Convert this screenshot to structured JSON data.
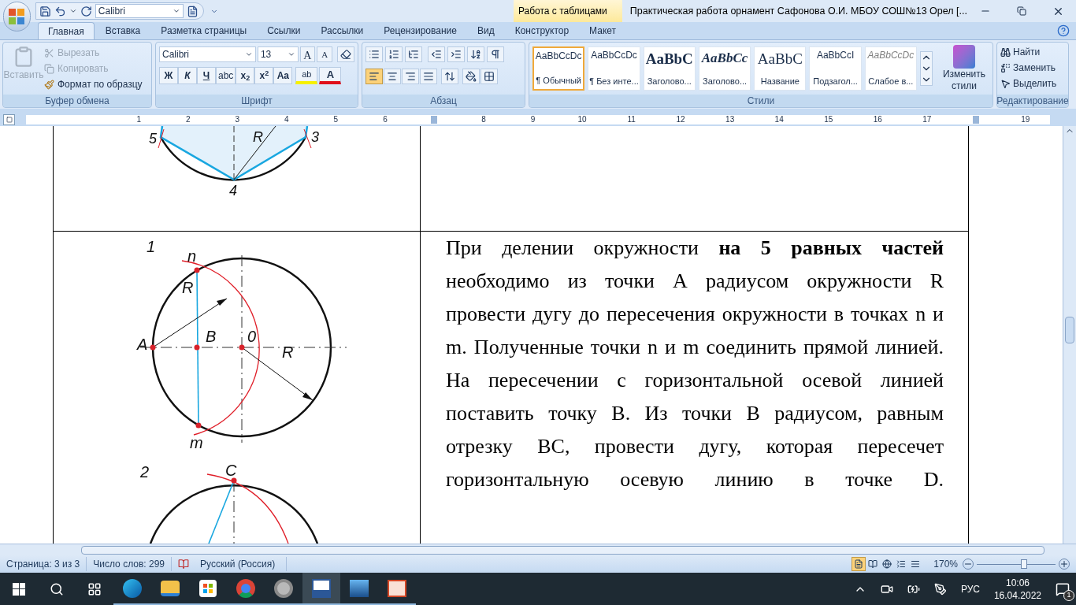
{
  "quick_access": {
    "font": "Calibri"
  },
  "contextual_tab_group": "Работа с таблицами",
  "window": {
    "title": "Практическая работа орнамент Сафонова О.И. МБОУ СОШ№13 Орел [..."
  },
  "tabs": [
    {
      "label": "Главная",
      "selected": true
    },
    {
      "label": "Вставка",
      "selected": false
    },
    {
      "label": "Разметка страницы",
      "selected": false
    },
    {
      "label": "Ссылки",
      "selected": false
    },
    {
      "label": "Рассылки",
      "selected": false
    },
    {
      "label": "Рецензирование",
      "selected": false
    },
    {
      "label": "Вид",
      "selected": false
    },
    {
      "label": "Конструктор",
      "selected": false
    },
    {
      "label": "Макет",
      "selected": false
    }
  ],
  "clipboard": {
    "paste": {
      "label": "Вставить",
      "disabled": true
    },
    "cut": {
      "label": "Вырезать",
      "disabled": true
    },
    "copy": {
      "label": "Копировать",
      "disabled": true
    },
    "format_painter": {
      "label": "Формат по образцу",
      "disabled": false
    },
    "group_label": "Буфер обмена"
  },
  "font": {
    "name": "Calibri",
    "size": "13",
    "grow_label": "A",
    "shrink_label": "A",
    "format_buttons": [
      "Ж",
      "К",
      "Ч",
      "abc",
      "x$_{2}$",
      "x$^{2}$",
      "Aa"
    ],
    "highlight_label": "ab",
    "color_label": "A",
    "group_label": "Шрифт"
  },
  "paragraph": {
    "alignments": [
      {
        "selected": true
      },
      {
        "selected": false
      },
      {
        "selected": false
      },
      {
        "selected": false
      }
    ],
    "group_label": "Абзац"
  },
  "styles": {
    "items": [
      {
        "kind": "normal",
        "sample": "AaBbCcDc",
        "name": "¶ Обычный",
        "selected": true
      },
      {
        "kind": "normal",
        "sample": "AaBbCcDc",
        "name": "¶ Без инте...",
        "selected": false
      },
      {
        "kind": "heading",
        "sample": "AaBbC",
        "name": "Заголово...",
        "selected": false
      },
      {
        "kind": "heading_italic",
        "sample": "AaBbCc",
        "name": "Заголово...",
        "selected": false
      },
      {
        "kind": "title",
        "sample": "AaBbC",
        "name": "Название",
        "selected": false
      },
      {
        "kind": "normal",
        "sample": "AaBbCcI",
        "name": "Подзагол...",
        "selected": false
      },
      {
        "kind": "subtle",
        "sample": "AaBbCcDc",
        "name": "Слабое в...",
        "selected": false
      }
    ],
    "change_label": "Изменить стили",
    "group_label": "Стили"
  },
  "editing": {
    "find": "Найти",
    "replace": "Заменить",
    "select": "Выделить",
    "group_label": "Редактирование"
  },
  "ruler": {
    "marks": [
      {
        "kind": "number",
        "label": "1"
      },
      {
        "kind": "number",
        "label": "2"
      },
      {
        "kind": "number",
        "label": "3"
      },
      {
        "kind": "number",
        "label": "4"
      },
      {
        "kind": "number",
        "label": "5"
      },
      {
        "kind": "number",
        "label": "6"
      },
      {
        "kind": "margin"
      },
      {
        "kind": "number",
        "label": "8"
      },
      {
        "kind": "number",
        "label": "9"
      },
      {
        "kind": "number",
        "label": "10"
      },
      {
        "kind": "number",
        "label": "11"
      },
      {
        "kind": "number",
        "label": "12"
      },
      {
        "kind": "number",
        "label": "13"
      },
      {
        "kind": "number",
        "label": "14"
      },
      {
        "kind": "number",
        "label": "15"
      },
      {
        "kind": "number",
        "label": "16"
      },
      {
        "kind": "number",
        "label": "17"
      },
      {
        "kind": "margin"
      },
      {
        "kind": "number",
        "label": "19"
      }
    ]
  },
  "document": {
    "figure_top_labels": [
      "5",
      "R",
      "3",
      "4"
    ],
    "figure_1_labels": [
      "1",
      "n",
      "R",
      "A",
      "B",
      "0",
      "R",
      "m"
    ],
    "figure_2_labels": [
      "2",
      "C"
    ],
    "paragraph": "При делении окружности **на 5 равных частей** необходимо из точки А радиусом окружности R провести дугу до пересечения окружности в точках n и m. Полученные точки n и m соединить прямой линией. На пересечении с горизонтальной осевой линией поставить точку В. Из точки В радиусом, равным отрезку ВС, провести дугу, которая пересечет горизонтальную осевую линию в точке D."
  },
  "status_bar": {
    "page": "Страница: 3 из 3",
    "words": "Число слов: 299",
    "language": "Русский (Россия)",
    "views": [
      {
        "selected": true
      },
      {
        "selected": false
      },
      {
        "selected": false
      },
      {
        "selected": false
      },
      {
        "selected": false
      }
    ],
    "zoom": "170%",
    "zoom_level": {
      "level": 0.6
    }
  },
  "taskbar": {
    "apps": [
      {
        "kind": "edge",
        "selected": false
      },
      {
        "kind": "explorer",
        "selected": false
      },
      {
        "kind": "store",
        "selected": false
      },
      {
        "kind": "chrome",
        "selected": false
      },
      {
        "kind": "media",
        "selected": false
      },
      {
        "kind": "word",
        "selected": true
      },
      {
        "kind": "photos",
        "selected": false
      },
      {
        "kind": "powerpoint",
        "selected": false
      }
    ],
    "language": "РУС",
    "time": "10:06",
    "date": "16.04.2022",
    "notifications": "1"
  }
}
